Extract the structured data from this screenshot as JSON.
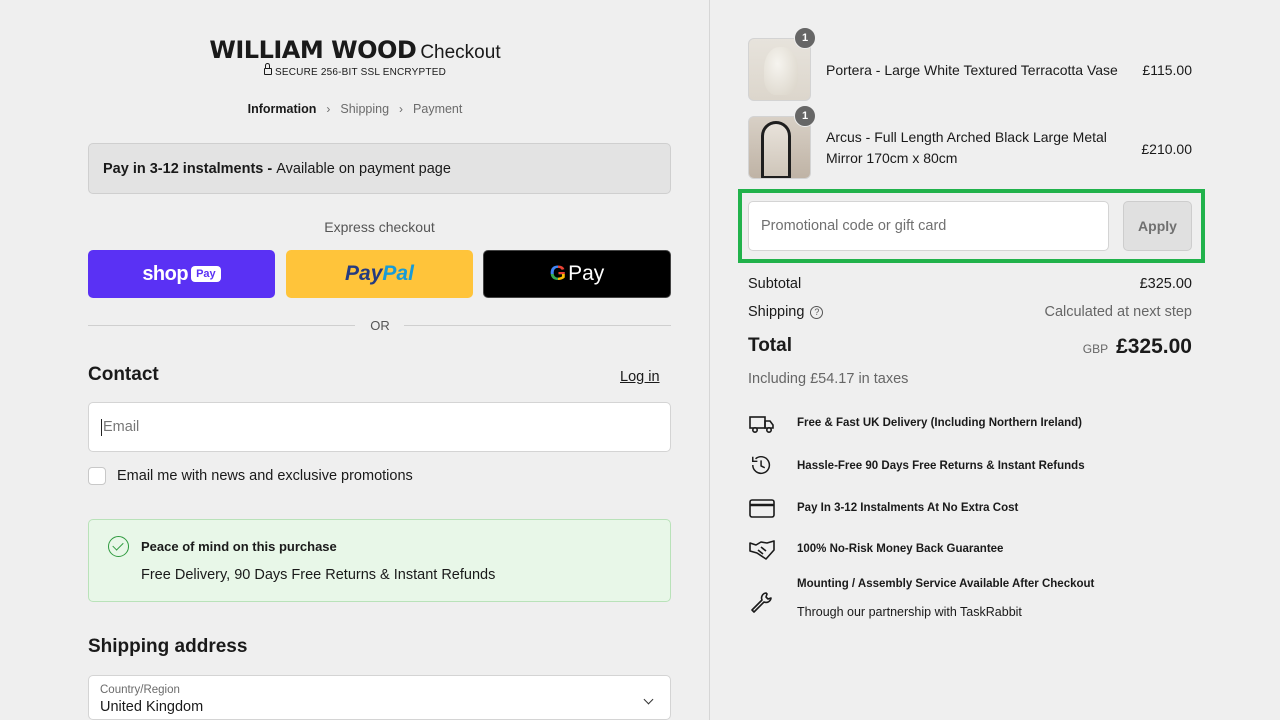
{
  "header": {
    "brand": "WILLIAM WOOD",
    "brand_suffix": "Checkout",
    "secure": "SECURE 256-BIT SSL ENCRYPTED"
  },
  "breadcrumbs": [
    "Information",
    "Shipping",
    "Payment"
  ],
  "banner": {
    "bold": "Pay in 3-12 instalments -",
    "text": "Available on payment page"
  },
  "express": {
    "label": "Express checkout",
    "shop_text": "shop",
    "shop_pill": "Pay",
    "paypal_a": "Pay",
    "paypal_b": "Pal",
    "gpay_g": "G",
    "gpay_text": "Pay",
    "or": "OR"
  },
  "contact": {
    "title": "Contact",
    "login": "Log in",
    "email_placeholder": "Email",
    "newsletter": "Email me with news and exclusive promotions"
  },
  "peace": {
    "title": "Peace of mind on this purchase",
    "text": "Free Delivery, 90 Days Free Returns & Instant Refunds"
  },
  "shipping": {
    "title": "Shipping address",
    "country_label": "Country/Region",
    "country_value": "United Kingdom"
  },
  "cart": {
    "items": [
      {
        "qty": "1",
        "name": "Portera - Large White Textured Terracotta Vase",
        "price": "£115.00"
      },
      {
        "qty": "1",
        "name_line1": "Arcus - Full Length Arched Black Large Metal",
        "name_line2": "Mirror 170cm x 80cm",
        "price": "£210.00"
      }
    ],
    "promo_placeholder": "Promotional code or gift card",
    "apply": "Apply",
    "subtotal_label": "Subtotal",
    "subtotal": "£325.00",
    "shipping_label": "Shipping",
    "shipping_value": "Calculated at next step",
    "total_label": "Total",
    "currency": "GBP",
    "total": "£325.00",
    "taxes": "Including £54.17 in taxes"
  },
  "features": [
    {
      "icon": "truck-icon",
      "text": "Free & Fast UK Delivery (Including Northern Ireland)"
    },
    {
      "icon": "clock-return-icon",
      "text": "Hassle-Free 90 Days Free Returns & Instant Refunds"
    },
    {
      "icon": "card-icon",
      "text": "Pay In 3-12 Instalments At No Extra Cost"
    },
    {
      "icon": "handshake-icon",
      "text": "100% No-Risk Money Back Guarantee"
    },
    {
      "icon": "wrench-icon",
      "text": "Mounting / Assembly Service Available After Checkout",
      "subtext": "Through our partnership with TaskRabbit"
    }
  ],
  "colors": {
    "shop": "#5a31f4",
    "paypal": "#ffc43a",
    "gpay": "#000000",
    "highlight": "#21b24b",
    "peace_bg": "#e8f7e8"
  }
}
